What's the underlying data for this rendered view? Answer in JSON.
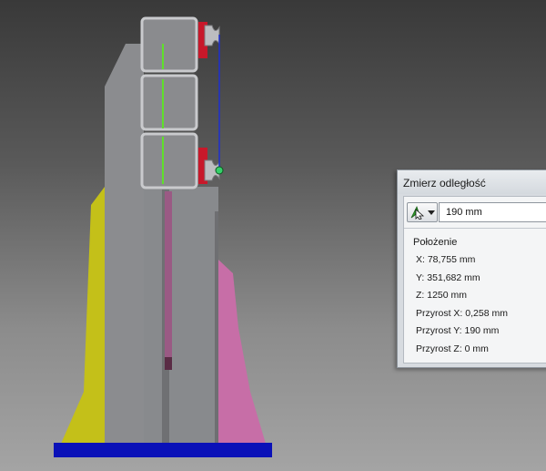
{
  "dialog": {
    "title": "Zmierz odległość",
    "distance_value": "190 mm",
    "section_title": "Położenie",
    "rows": [
      "X: 78,755 mm",
      "Y: 351,682 mm",
      "Z: 1250 mm",
      "Przyrost X: 0,258 mm",
      "Przyrost Y: 190 mm",
      "Przyrost Z: 0 mm"
    ]
  },
  "viewport": {
    "background_top": "#393939",
    "background_bottom": "#a4a4a4",
    "colors": {
      "column": "#8b8c8f",
      "yellow_part": "#c4c019",
      "pink_part": "#c76ea7",
      "base_plate": "#0a11b8",
      "measure_line": "#1d2fd0",
      "axis_line": "#5fe02a",
      "red_block": "#c8182a",
      "pick_point": "#36d06a"
    }
  }
}
